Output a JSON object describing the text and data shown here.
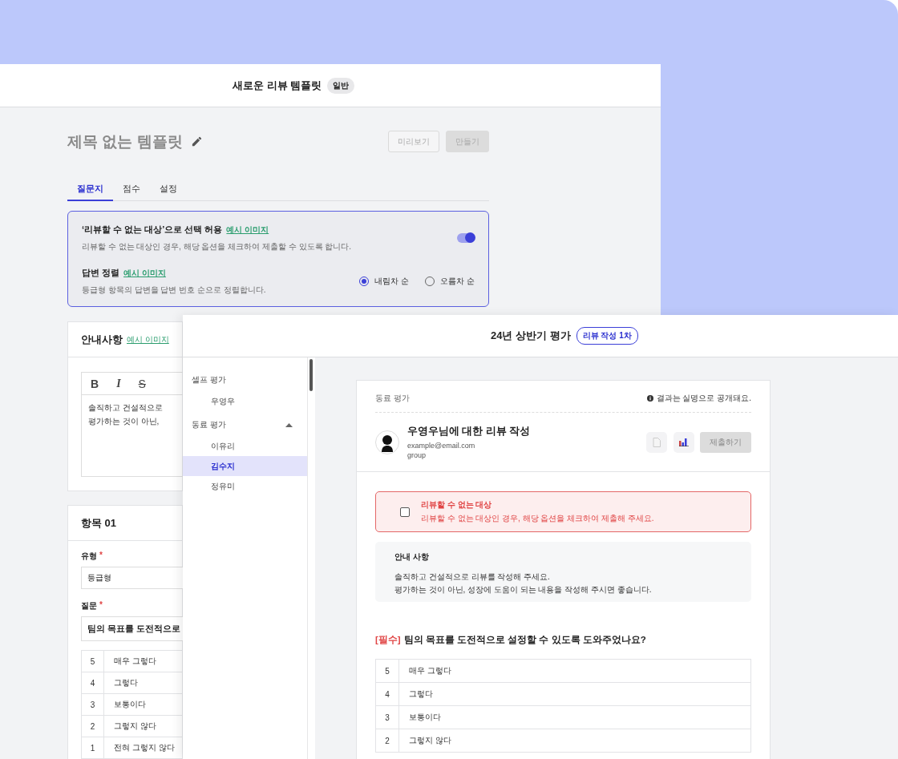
{
  "back_window": {
    "title": "새로운 리뷰 템플릿",
    "badge": "일반",
    "template_title": "제목 없는 템플릿",
    "buttons": [
      {
        "label": "미리보기",
        "kind": "outline",
        "disabled": true
      },
      {
        "label": "만들기",
        "kind": "filled",
        "disabled": true
      }
    ],
    "tabs": [
      {
        "label": "질문지",
        "selected": true
      },
      {
        "label": "점수",
        "selected": false
      },
      {
        "label": "설정",
        "selected": false
      }
    ],
    "settings": [
      {
        "kind": "toggle",
        "title": "‘리뷰할 수 없는 대상’으로 선택 허용",
        "link": "예시 이미지",
        "description": "리뷰할 수 없는 대상인 경우, 해당 옵션을 체크하여 제출할 수 있도록 합니다.",
        "on": true
      },
      {
        "kind": "radio",
        "title": "답변 정렬",
        "link": "예시 이미지",
        "description": "등급형 항목의 답변을 답변 번호 순으로 정렬합니다.",
        "options": [
          {
            "label": "내림차 순",
            "selected": true
          },
          {
            "label": "오름차 순",
            "selected": false
          }
        ]
      }
    ],
    "notice": {
      "title": "안내사항",
      "link": "예시 이미지",
      "toolbar": [
        {
          "label": "B",
          "kind": "bold"
        },
        {
          "label": "I",
          "kind": "italic"
        },
        {
          "label": "S",
          "kind": "strike"
        }
      ],
      "lines": [
        "솔직하고 건설적으로",
        "평가하는 것이 아닌,"
      ]
    },
    "item": {
      "title": "항목 01",
      "fields": [
        {
          "label": "유형",
          "required_mark": "*",
          "value": "등급형"
        },
        {
          "label": "질문",
          "required_mark": "*",
          "value": "팀의 목표를 도전적으로"
        }
      ],
      "scale": [
        {
          "score": "5",
          "label": "매우 그렇다"
        },
        {
          "score": "4",
          "label": "그렇다"
        },
        {
          "score": "3",
          "label": "보통이다"
        },
        {
          "score": "2",
          "label": "그렇지 않다"
        },
        {
          "score": "1",
          "label": "전혀 그렇지 않다"
        }
      ]
    }
  },
  "front_window": {
    "title": "24년 상반기 평가",
    "badge": "리뷰 작성 1차",
    "sidebar": [
      {
        "label": "셀프 평가",
        "kind": "static",
        "children": [
          {
            "label": "우영우",
            "selected": false
          }
        ]
      },
      {
        "label": "동료 평가",
        "kind": "collapsible",
        "expanded": true,
        "children": [
          {
            "label": "이유리",
            "selected": false
          },
          {
            "label": "김수지",
            "selected": true
          },
          {
            "label": "정유미",
            "selected": false
          }
        ]
      }
    ],
    "review": {
      "section": "동료 평가",
      "notice": "결과는 실명으로 공개돼요.",
      "reviewee": {
        "heading": "우영우님에 대한 리뷰 작성",
        "email": "example@email.com",
        "group": "group"
      },
      "submit": {
        "label": "제출하기",
        "disabled": true
      },
      "exclude": {
        "title": "리뷰할 수 없는 대상",
        "description": "리뷰할 수 없는 대상인 경우, 해당 옵션을 체크하여 제출해 주세요.",
        "checked": false
      },
      "guide": {
        "title": "안내 사항",
        "lines": [
          "솔직하고 건설적으로 리뷰를 작성해 주세요.",
          "평가하는 것이 아닌, 성장에 도움이 되는 내용을 작성해 주시면 좋습니다."
        ]
      },
      "question": {
        "tag": "[필수]",
        "text": "팀의 목표를 도전적으로 설정할 수 있도록 도와주었나요?",
        "options": [
          {
            "score": "5",
            "label": "매우 그렇다"
          },
          {
            "score": "4",
            "label": "그렇다"
          },
          {
            "score": "3",
            "label": "보통이다"
          },
          {
            "score": "2",
            "label": "그렇지 않다"
          }
        ]
      }
    }
  }
}
